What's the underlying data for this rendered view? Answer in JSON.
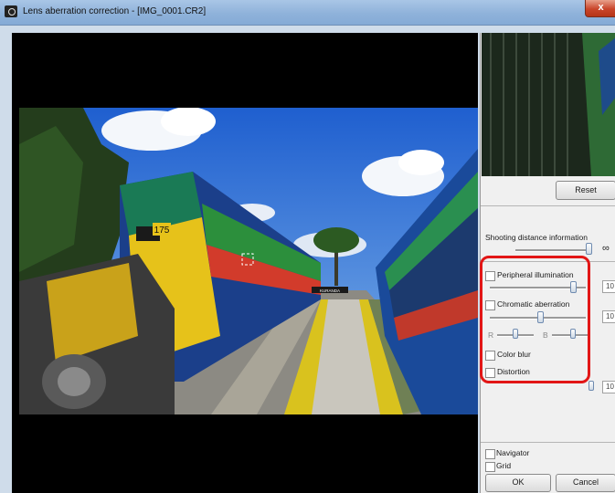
{
  "window": {
    "title": "Lens aberration correction - [IMG_0001.CR2]",
    "close_label": "x"
  },
  "panel": {
    "reset_label": "Reset",
    "shooting_distance_label": "Shooting distance information",
    "infinity_symbol": "∞",
    "peripheral_label": "Peripheral illumination",
    "peripheral_value": "10",
    "chromatic_label": "Chromatic aberration",
    "chromatic_value": "10",
    "r_label": "R",
    "b_label": "B",
    "color_blur_label": "Color blur",
    "distortion_label": "Distortion",
    "distortion_value": "10",
    "navigator_label": "Navigator",
    "grid_label": "Grid",
    "ok_label": "OK",
    "cancel_label": "Cancel"
  },
  "photo": {
    "station_sign": "KURANDA",
    "loco_number": "175"
  },
  "colors": {
    "highlight": "#e21616",
    "titlebar": "#8fb2da",
    "sky": "#3b78d8"
  }
}
